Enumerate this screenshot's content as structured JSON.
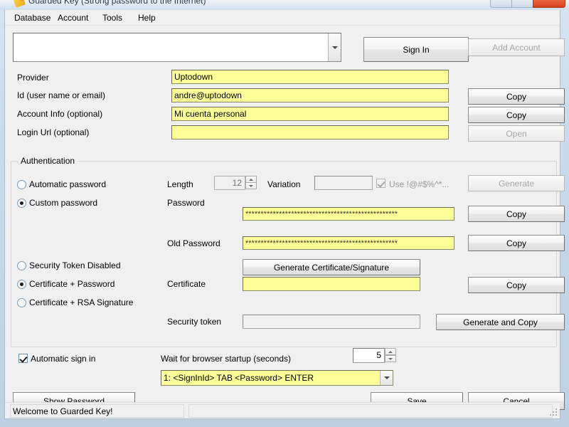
{
  "window": {
    "title": "Guarded Key (Strong password to the Internet)",
    "icon": "key-icon",
    "controls": {
      "minimize": "minimize-icon",
      "maximize": "maximize-icon",
      "close": "close-icon"
    }
  },
  "menubar": {
    "items": [
      {
        "label": "Database"
      },
      {
        "label": "Account"
      },
      {
        "label": "Tools"
      },
      {
        "label": "Help"
      }
    ]
  },
  "top": {
    "account_combo_value": "",
    "sign_in_label": "Sign In",
    "add_account_label": "Add Account"
  },
  "fields": {
    "provider": {
      "label": "Provider",
      "value": "Uptodown"
    },
    "id": {
      "label": "Id (user name or email)",
      "value": "andre@uptodown",
      "button": "Copy"
    },
    "account_info": {
      "label": "Account Info (optional)",
      "value": "Mi cuenta personal",
      "button": "Copy"
    },
    "login_url": {
      "label": "Login Url (optional)",
      "value": "",
      "button": "Open"
    }
  },
  "authentication": {
    "group_title": "Authentication",
    "password_mode": {
      "automatic": "Automatic password",
      "custom": "Custom password",
      "selected": "custom"
    },
    "length": {
      "label": "Length",
      "value": "12"
    },
    "variation": {
      "label": "Variation",
      "value": ""
    },
    "special_chars": {
      "label": "Use !@#$%^*...",
      "checked": true,
      "disabled": true
    },
    "generate_label": "Generate",
    "password": {
      "label": "Password",
      "value": "**************************************************",
      "button": "Copy"
    },
    "old_password": {
      "label": "Old Password",
      "value": "**************************************************",
      "button": "Copy"
    },
    "token_mode": {
      "disabled_opt": "Security Token Disabled",
      "cert_password": "Certificate + Password",
      "cert_rsa": "Certificate + RSA Signature",
      "selected": "cert_password"
    },
    "generate_cert_label": "Generate Certificate/Signature",
    "certificate": {
      "label": "Certificate",
      "value": "",
      "button": "Copy"
    },
    "security_token": {
      "label": "Security token",
      "value": "",
      "button": "Generate and Copy"
    }
  },
  "bottom": {
    "automatic_sign_in": {
      "label": "Automatic sign in",
      "checked": true
    },
    "wait_label": "Wait for browser startup (seconds)",
    "wait_value": "5",
    "script_combo_value": "1: <SignInId> TAB <Password> ENTER",
    "show_password_label": "Show Password",
    "save_label": "Save",
    "cancel_label": "Cancel"
  },
  "statusbar": {
    "left": "Welcome to Guarded Key!",
    "right": ""
  },
  "colors": {
    "field_yellow": "#ffff99",
    "window_bg": "#f0f0f0",
    "close_button": "#e8613a",
    "frame_blue": "#c9d9e8"
  }
}
